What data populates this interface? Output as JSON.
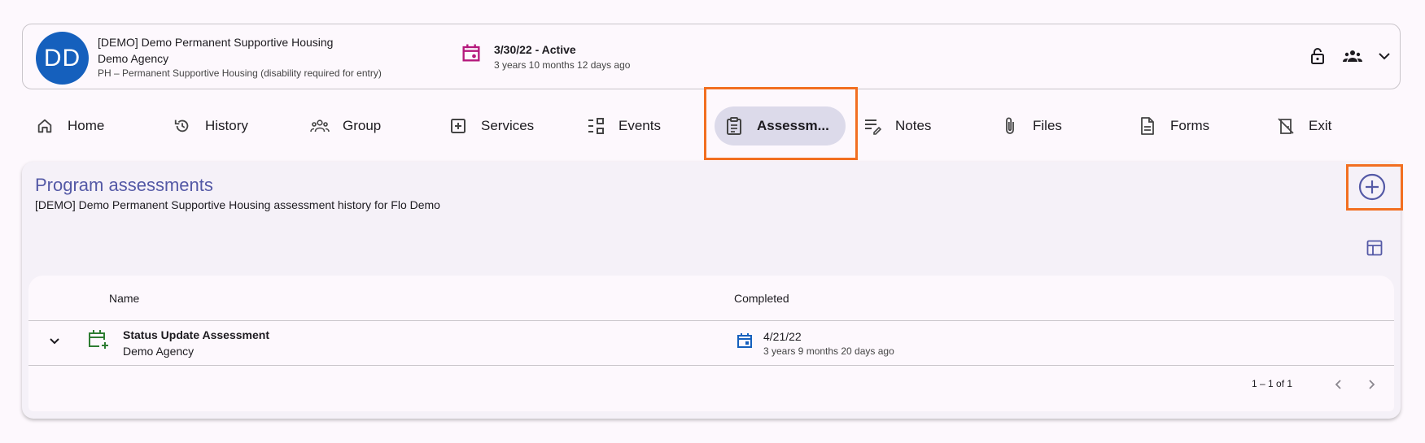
{
  "header": {
    "avatar_initials": "DD",
    "program_name": "[DEMO] Demo Permanent Supportive Housing",
    "agency": "Demo Agency",
    "program_type": "PH – Permanent Supportive Housing (disability required for entry)",
    "enrollment_status": "3/30/22 - Active",
    "enrollment_ago": "3 years 10 months 12 days ago",
    "icons": [
      "calendar-icon",
      "lock-icon",
      "group-icon",
      "chevron-down-icon"
    ]
  },
  "nav": {
    "items": [
      {
        "label": "Home",
        "icon": "home-icon"
      },
      {
        "label": "History",
        "icon": "history-icon"
      },
      {
        "label": "Group",
        "icon": "group-icon"
      },
      {
        "label": "Services",
        "icon": "add-box-icon"
      },
      {
        "label": "Events",
        "icon": "events-icon"
      },
      {
        "label": "Assessm...",
        "icon": "clipboard-icon",
        "active": true
      },
      {
        "label": "Notes",
        "icon": "notes-edit-icon"
      },
      {
        "label": "Files",
        "icon": "paperclip-icon"
      },
      {
        "label": "Forms",
        "icon": "document-icon"
      },
      {
        "label": "Exit",
        "icon": "exit-door-icon"
      }
    ]
  },
  "panel": {
    "title": "Program assessments",
    "subtitle": "[DEMO] Demo Permanent Supportive Housing assessment history for Flo Demo"
  },
  "table": {
    "columns": [
      "Name",
      "Completed"
    ],
    "rows": [
      {
        "name": "Status Update Assessment",
        "agency": "Demo Agency",
        "completed": "4/21/22",
        "completed_ago": "3 years 9 months 20 days ago"
      }
    ],
    "pagination": "1 – 1 of 1"
  },
  "colors": {
    "accent": "#5459a6",
    "avatar": "#1560bd",
    "enrollment_icon": "#b5187c",
    "assessment_icon": "#2e7d32",
    "highlight": "#f26f21",
    "active_tab_bg": "#dcdaea"
  }
}
